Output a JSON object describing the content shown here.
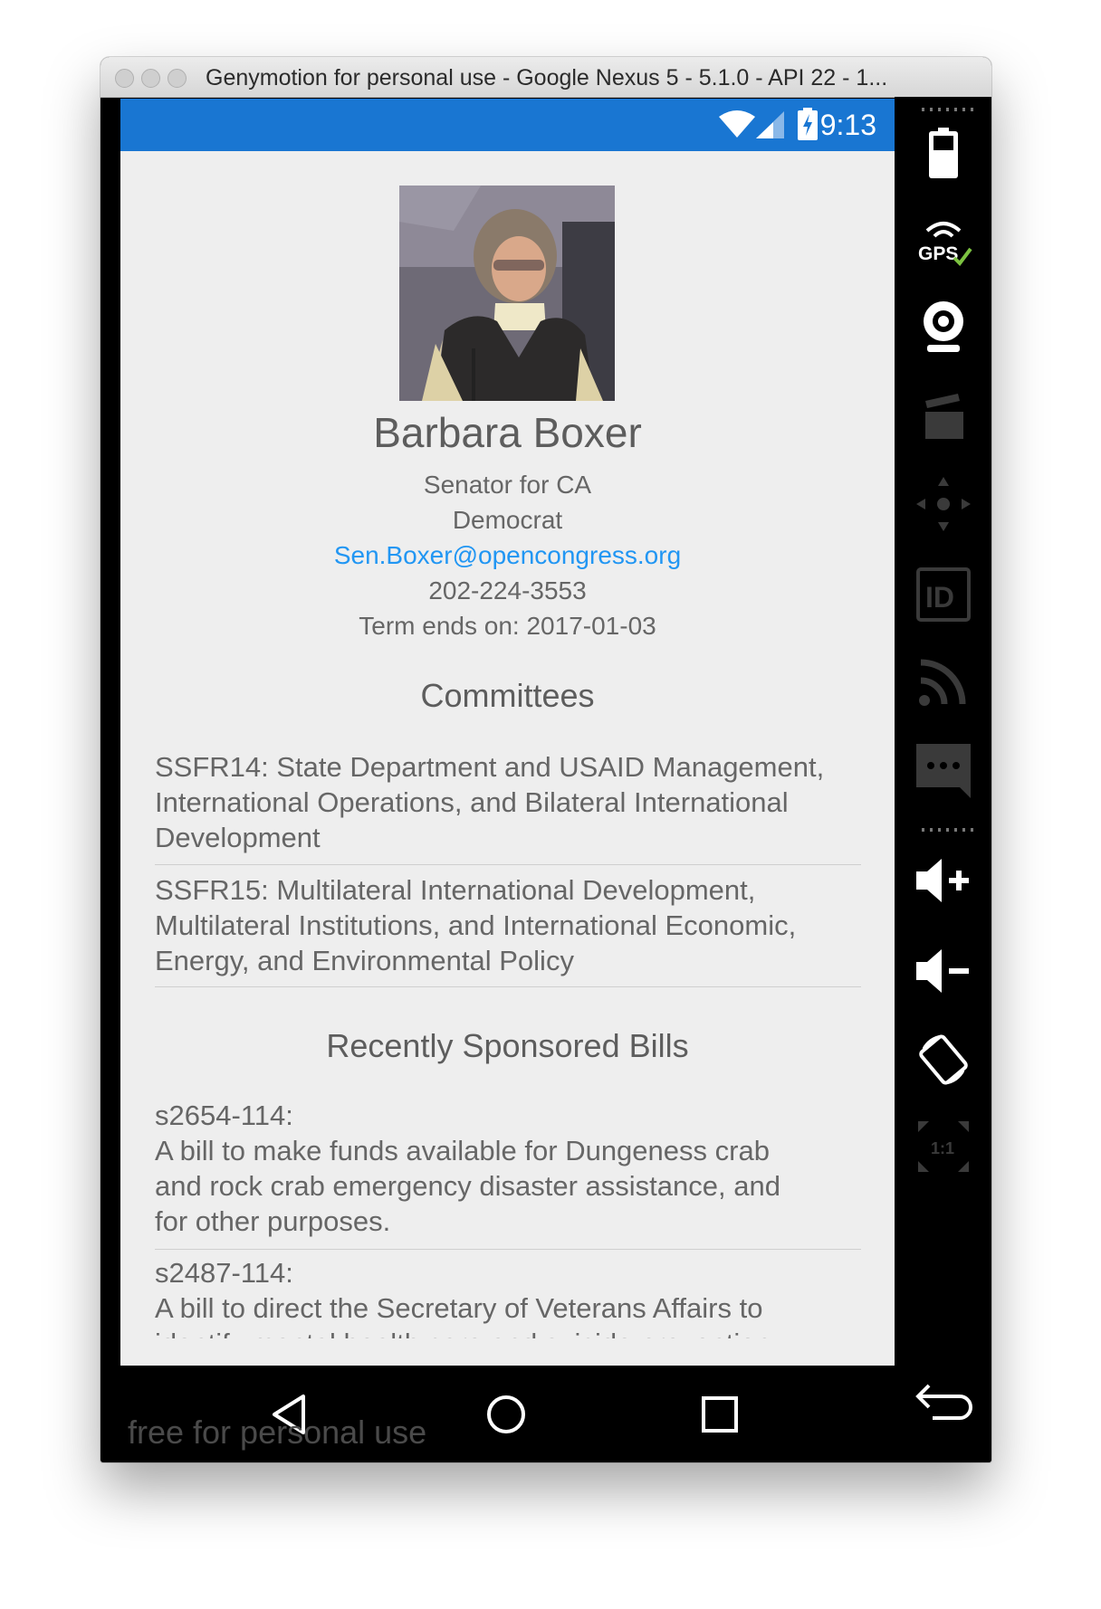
{
  "window": {
    "title": "Genymotion for personal use - Google Nexus 5 - 5.1.0 - API 22 - 1..."
  },
  "status_bar": {
    "time": "9:13",
    "color": "#1976d2"
  },
  "profile": {
    "name": "Barbara Boxer",
    "role": "Senator for CA",
    "party": "Democrat",
    "email": "Sen.Boxer@opencongress.org",
    "phone": "202-224-3553",
    "term": "Term ends on: 2017-01-03"
  },
  "committees": {
    "heading": "Committees",
    "items": [
      {
        "lines": [
          "SSFR14: State Department and USAID Management,",
          "International Operations, and Bilateral International",
          "Development"
        ]
      },
      {
        "lines": [
          "SSFR15: Multilateral International Development,",
          "Multilateral Institutions, and International Economic,",
          "Energy, and Environmental Policy"
        ]
      }
    ]
  },
  "bills": {
    "heading": "Recently Sponsored Bills",
    "items": [
      {
        "id": "s2654-114:",
        "lines": [
          "A bill to make funds available for Dungeness crab",
          "and rock crab emergency disaster assistance, and",
          "for other purposes."
        ]
      },
      {
        "id": "s2487-114:",
        "lines": [
          "A bill to direct the Secretary of Veterans Affairs to",
          "identify mental health care and suicide prevention"
        ]
      }
    ]
  },
  "watermark": "free for personal use",
  "icons": {
    "sidebar": [
      "battery-icon",
      "gps-icon",
      "webcam-icon",
      "capture-icon",
      "dpad-icon",
      "id-icon",
      "cast-icon",
      "sms-icon",
      "volume-up-icon",
      "volume-down-icon",
      "rotate-icon",
      "scale-icon",
      "back-icon",
      "menu-icon"
    ],
    "nav": [
      "nav-back-icon",
      "nav-home-icon",
      "nav-recents-icon"
    ]
  }
}
